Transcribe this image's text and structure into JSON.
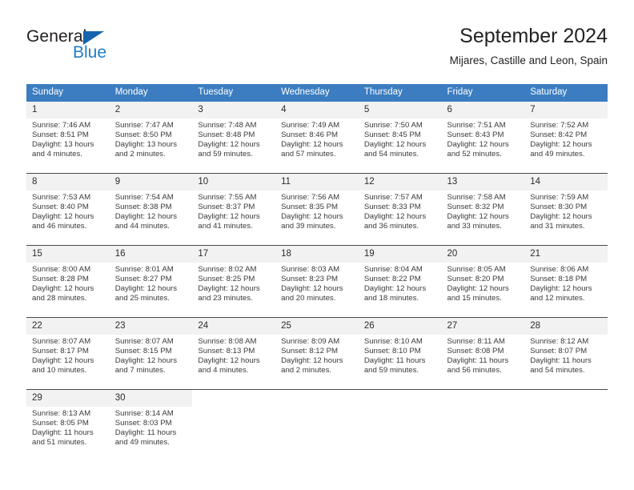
{
  "brand": {
    "name_top": "General",
    "name_bottom": "Blue",
    "accent_color": "#1f7ec4",
    "triangle_color": "#1464ad"
  },
  "header": {
    "title": "September 2024",
    "location": "Mijares, Castille and Leon, Spain"
  },
  "calendar": {
    "header_bg": "#3b7dc0",
    "daynum_bg": "#f2f2f2",
    "weekdays": [
      "Sunday",
      "Monday",
      "Tuesday",
      "Wednesday",
      "Thursday",
      "Friday",
      "Saturday"
    ],
    "labels": {
      "sunrise": "Sunrise:",
      "sunset": "Sunset:",
      "daylight": "Daylight:"
    },
    "weeks": [
      [
        {
          "day": "1",
          "sunrise": "Sunrise: 7:46 AM",
          "sunset": "Sunset: 8:51 PM",
          "daylight_1": "Daylight: 13 hours",
          "daylight_2": "and 4 minutes."
        },
        {
          "day": "2",
          "sunrise": "Sunrise: 7:47 AM",
          "sunset": "Sunset: 8:50 PM",
          "daylight_1": "Daylight: 13 hours",
          "daylight_2": "and 2 minutes."
        },
        {
          "day": "3",
          "sunrise": "Sunrise: 7:48 AM",
          "sunset": "Sunset: 8:48 PM",
          "daylight_1": "Daylight: 12 hours",
          "daylight_2": "and 59 minutes."
        },
        {
          "day": "4",
          "sunrise": "Sunrise: 7:49 AM",
          "sunset": "Sunset: 8:46 PM",
          "daylight_1": "Daylight: 12 hours",
          "daylight_2": "and 57 minutes."
        },
        {
          "day": "5",
          "sunrise": "Sunrise: 7:50 AM",
          "sunset": "Sunset: 8:45 PM",
          "daylight_1": "Daylight: 12 hours",
          "daylight_2": "and 54 minutes."
        },
        {
          "day": "6",
          "sunrise": "Sunrise: 7:51 AM",
          "sunset": "Sunset: 8:43 PM",
          "daylight_1": "Daylight: 12 hours",
          "daylight_2": "and 52 minutes."
        },
        {
          "day": "7",
          "sunrise": "Sunrise: 7:52 AM",
          "sunset": "Sunset: 8:42 PM",
          "daylight_1": "Daylight: 12 hours",
          "daylight_2": "and 49 minutes."
        }
      ],
      [
        {
          "day": "8",
          "sunrise": "Sunrise: 7:53 AM",
          "sunset": "Sunset: 8:40 PM",
          "daylight_1": "Daylight: 12 hours",
          "daylight_2": "and 46 minutes."
        },
        {
          "day": "9",
          "sunrise": "Sunrise: 7:54 AM",
          "sunset": "Sunset: 8:38 PM",
          "daylight_1": "Daylight: 12 hours",
          "daylight_2": "and 44 minutes."
        },
        {
          "day": "10",
          "sunrise": "Sunrise: 7:55 AM",
          "sunset": "Sunset: 8:37 PM",
          "daylight_1": "Daylight: 12 hours",
          "daylight_2": "and 41 minutes."
        },
        {
          "day": "11",
          "sunrise": "Sunrise: 7:56 AM",
          "sunset": "Sunset: 8:35 PM",
          "daylight_1": "Daylight: 12 hours",
          "daylight_2": "and 39 minutes."
        },
        {
          "day": "12",
          "sunrise": "Sunrise: 7:57 AM",
          "sunset": "Sunset: 8:33 PM",
          "daylight_1": "Daylight: 12 hours",
          "daylight_2": "and 36 minutes."
        },
        {
          "day": "13",
          "sunrise": "Sunrise: 7:58 AM",
          "sunset": "Sunset: 8:32 PM",
          "daylight_1": "Daylight: 12 hours",
          "daylight_2": "and 33 minutes."
        },
        {
          "day": "14",
          "sunrise": "Sunrise: 7:59 AM",
          "sunset": "Sunset: 8:30 PM",
          "daylight_1": "Daylight: 12 hours",
          "daylight_2": "and 31 minutes."
        }
      ],
      [
        {
          "day": "15",
          "sunrise": "Sunrise: 8:00 AM",
          "sunset": "Sunset: 8:28 PM",
          "daylight_1": "Daylight: 12 hours",
          "daylight_2": "and 28 minutes."
        },
        {
          "day": "16",
          "sunrise": "Sunrise: 8:01 AM",
          "sunset": "Sunset: 8:27 PM",
          "daylight_1": "Daylight: 12 hours",
          "daylight_2": "and 25 minutes."
        },
        {
          "day": "17",
          "sunrise": "Sunrise: 8:02 AM",
          "sunset": "Sunset: 8:25 PM",
          "daylight_1": "Daylight: 12 hours",
          "daylight_2": "and 23 minutes."
        },
        {
          "day": "18",
          "sunrise": "Sunrise: 8:03 AM",
          "sunset": "Sunset: 8:23 PM",
          "daylight_1": "Daylight: 12 hours",
          "daylight_2": "and 20 minutes."
        },
        {
          "day": "19",
          "sunrise": "Sunrise: 8:04 AM",
          "sunset": "Sunset: 8:22 PM",
          "daylight_1": "Daylight: 12 hours",
          "daylight_2": "and 18 minutes."
        },
        {
          "day": "20",
          "sunrise": "Sunrise: 8:05 AM",
          "sunset": "Sunset: 8:20 PM",
          "daylight_1": "Daylight: 12 hours",
          "daylight_2": "and 15 minutes."
        },
        {
          "day": "21",
          "sunrise": "Sunrise: 8:06 AM",
          "sunset": "Sunset: 8:18 PM",
          "daylight_1": "Daylight: 12 hours",
          "daylight_2": "and 12 minutes."
        }
      ],
      [
        {
          "day": "22",
          "sunrise": "Sunrise: 8:07 AM",
          "sunset": "Sunset: 8:17 PM",
          "daylight_1": "Daylight: 12 hours",
          "daylight_2": "and 10 minutes."
        },
        {
          "day": "23",
          "sunrise": "Sunrise: 8:07 AM",
          "sunset": "Sunset: 8:15 PM",
          "daylight_1": "Daylight: 12 hours",
          "daylight_2": "and 7 minutes."
        },
        {
          "day": "24",
          "sunrise": "Sunrise: 8:08 AM",
          "sunset": "Sunset: 8:13 PM",
          "daylight_1": "Daylight: 12 hours",
          "daylight_2": "and 4 minutes."
        },
        {
          "day": "25",
          "sunrise": "Sunrise: 8:09 AM",
          "sunset": "Sunset: 8:12 PM",
          "daylight_1": "Daylight: 12 hours",
          "daylight_2": "and 2 minutes."
        },
        {
          "day": "26",
          "sunrise": "Sunrise: 8:10 AM",
          "sunset": "Sunset: 8:10 PM",
          "daylight_1": "Daylight: 11 hours",
          "daylight_2": "and 59 minutes."
        },
        {
          "day": "27",
          "sunrise": "Sunrise: 8:11 AM",
          "sunset": "Sunset: 8:08 PM",
          "daylight_1": "Daylight: 11 hours",
          "daylight_2": "and 56 minutes."
        },
        {
          "day": "28",
          "sunrise": "Sunrise: 8:12 AM",
          "sunset": "Sunset: 8:07 PM",
          "daylight_1": "Daylight: 11 hours",
          "daylight_2": "and 54 minutes."
        }
      ],
      [
        {
          "day": "29",
          "sunrise": "Sunrise: 8:13 AM",
          "sunset": "Sunset: 8:05 PM",
          "daylight_1": "Daylight: 11 hours",
          "daylight_2": "and 51 minutes."
        },
        {
          "day": "30",
          "sunrise": "Sunrise: 8:14 AM",
          "sunset": "Sunset: 8:03 PM",
          "daylight_1": "Daylight: 11 hours",
          "daylight_2": "and 49 minutes."
        },
        {
          "day": "",
          "sunrise": "",
          "sunset": "",
          "daylight_1": "",
          "daylight_2": ""
        },
        {
          "day": "",
          "sunrise": "",
          "sunset": "",
          "daylight_1": "",
          "daylight_2": ""
        },
        {
          "day": "",
          "sunrise": "",
          "sunset": "",
          "daylight_1": "",
          "daylight_2": ""
        },
        {
          "day": "",
          "sunrise": "",
          "sunset": "",
          "daylight_1": "",
          "daylight_2": ""
        },
        {
          "day": "",
          "sunrise": "",
          "sunset": "",
          "daylight_1": "",
          "daylight_2": ""
        }
      ]
    ]
  }
}
